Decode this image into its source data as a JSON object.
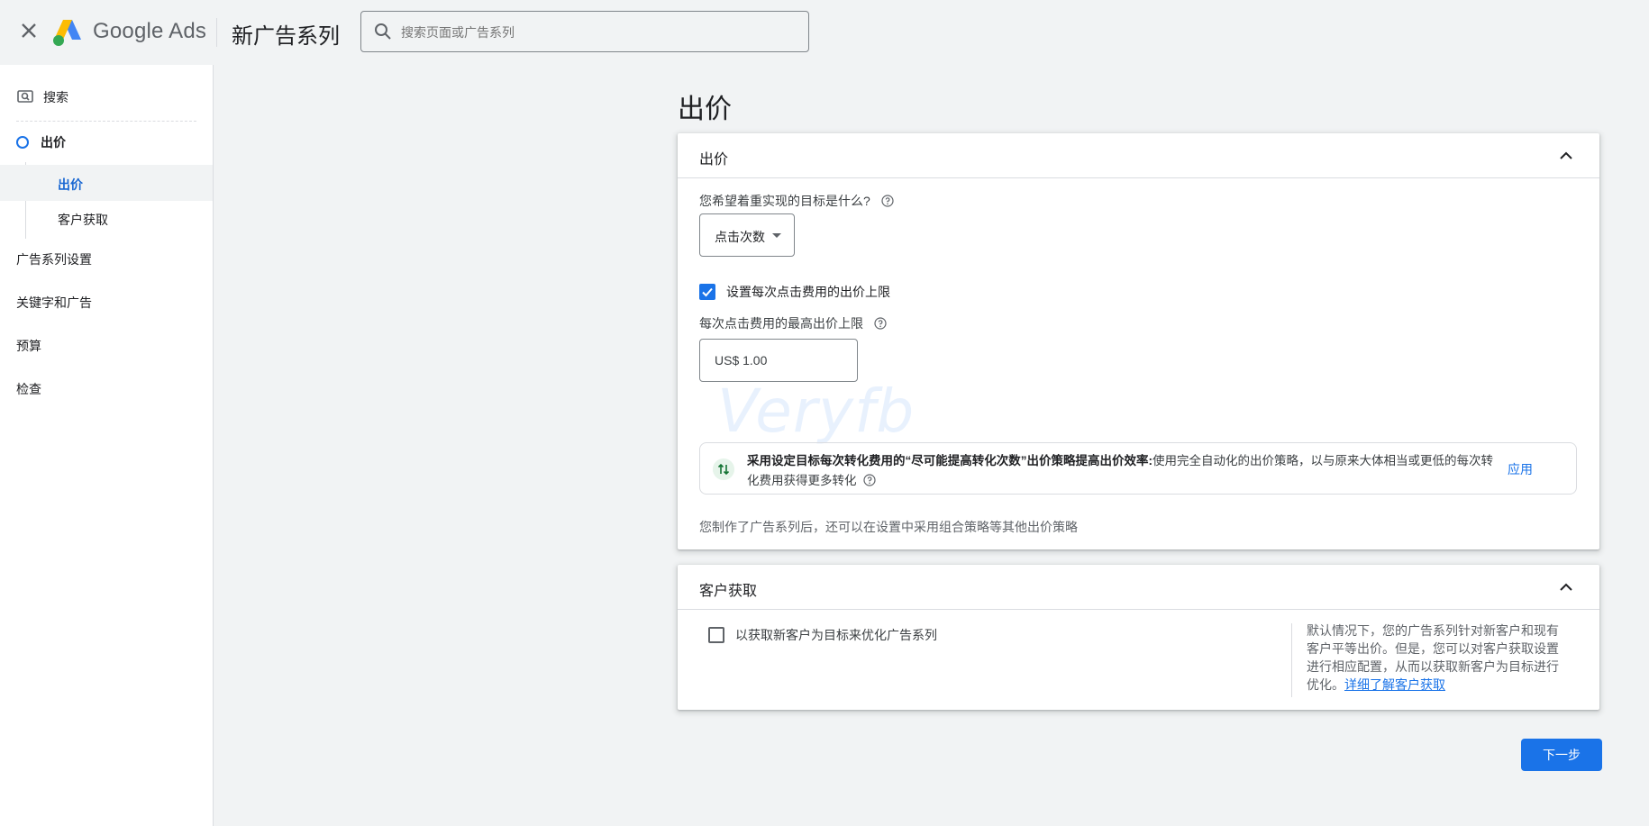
{
  "header": {
    "brand": "Google Ads",
    "page_title": "新广告系列",
    "search_placeholder": "搜索页面或广告系列"
  },
  "sidebar": {
    "search_label": "搜索",
    "bidding_label": "出价",
    "sub_items": [
      "出价",
      "客户获取"
    ],
    "items": [
      "广告系列设置",
      "关键字和广告",
      "预算",
      "检查"
    ]
  },
  "main": {
    "title": "出价",
    "bidding_card": {
      "title": "出价",
      "question": "您希望着重实现的目标是什么?",
      "goal_value": "点击次数",
      "max_cpc_checkbox_label": "设置每次点击费用的出价上限",
      "max_cpc_checked": true,
      "max_cpc_label": "每次点击费用的最高出价上限",
      "max_cpc_value": "US$ 1.00",
      "watermark": "Veryfb",
      "recommendation_bold": "采用设定目标每次转化费用的“尽可能提高转化次数”出价策略提高出价效率:",
      "recommendation_text": "使用完全自动化的出价策略，以与原来大体相当或更低的每次转化费用获得更多转化",
      "apply_label": "应用",
      "footer_note": "您制作了广告系列后，还可以在设置中采用组合策略等其他出价策略"
    },
    "acquisition_card": {
      "title": "客户获取",
      "checkbox_label": "以获取新客户为目标来优化广告系列",
      "checked": false,
      "description": "默认情况下，您的广告系列针对新客户和现有客户平等出价。但是，您可以对客户获取设置进行相应配置，从而以获取新客户为目标进行优化。",
      "learn_more": "详细了解客户获取"
    },
    "next_label": "下一步"
  },
  "colors": {
    "accent": "#1a73e8",
    "background": "#f1f3f4"
  },
  "icons": [
    "close-icon",
    "google-ads-logo",
    "search-icon",
    "help-icon",
    "chevron-up-icon",
    "checkmark-icon",
    "arrows-icon"
  ]
}
